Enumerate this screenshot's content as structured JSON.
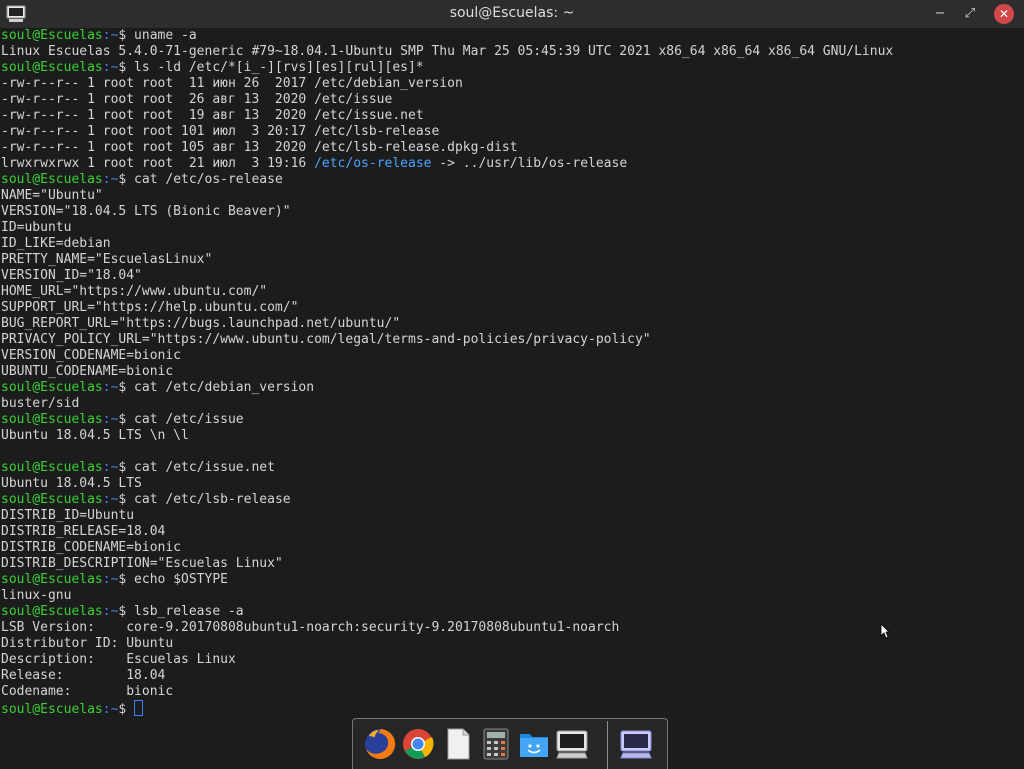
{
  "window": {
    "title": "soul@Escuelas: ~",
    "minimize_glyph": "−",
    "maximize_glyph": "⤢",
    "close_glyph": "✕"
  },
  "prompt": {
    "user": "soul@Escuelas",
    "path": ":~",
    "symbol": "$"
  },
  "terminal": {
    "lines": [
      {
        "p": true,
        "t": " uname -a"
      },
      {
        "t": "Linux Escuelas 5.4.0-71-generic #79~18.04.1-Ubuntu SMP Thu Mar 25 05:45:39 UTC 2021 x86_64 x86_64 x86_64 GNU/Linux"
      },
      {
        "p": true,
        "t": " ls -ld /etc/*[i_-][rvs][es][rul][es]*"
      },
      {
        "t": "-rw-r--r-- 1 root root  11 июн 26  2017 /etc/debian_version"
      },
      {
        "t": "-rw-r--r-- 1 root root  26 авг 13  2020 /etc/issue"
      },
      {
        "t": "-rw-r--r-- 1 root root  19 авг 13  2020 /etc/issue.net"
      },
      {
        "t": "-rw-r--r-- 1 root root 101 июл  3 20:17 /etc/lsb-release"
      },
      {
        "t": "-rw-r--r-- 1 root root 105 авг 13  2020 /etc/lsb-release.dpkg-dist"
      },
      {
        "t": "lrwxrwxrwx 1 root root  21 июл  3 19:16 ",
        "hl": "/etc/os-release",
        "t2": " -> ../usr/lib/os-release"
      },
      {
        "p": true,
        "t": " cat /etc/os-release"
      },
      {
        "t": "NAME=\"Ubuntu\""
      },
      {
        "t": "VERSION=\"18.04.5 LTS (Bionic Beaver)\""
      },
      {
        "t": "ID=ubuntu"
      },
      {
        "t": "ID_LIKE=debian"
      },
      {
        "t": "PRETTY_NAME=\"EscuelasLinux\""
      },
      {
        "t": "VERSION_ID=\"18.04\""
      },
      {
        "t": "HOME_URL=\"https://www.ubuntu.com/\""
      },
      {
        "t": "SUPPORT_URL=\"https://help.ubuntu.com/\""
      },
      {
        "t": "BUG_REPORT_URL=\"https://bugs.launchpad.net/ubuntu/\""
      },
      {
        "t": "PRIVACY_POLICY_URL=\"https://www.ubuntu.com/legal/terms-and-policies/privacy-policy\""
      },
      {
        "t": "VERSION_CODENAME=bionic"
      },
      {
        "t": "UBUNTU_CODENAME=bionic"
      },
      {
        "p": true,
        "t": " cat /etc/debian_version"
      },
      {
        "t": "buster/sid"
      },
      {
        "p": true,
        "t": " cat /etc/issue"
      },
      {
        "t": "Ubuntu 18.04.5 LTS \\n \\l"
      },
      {
        "t": ""
      },
      {
        "p": true,
        "t": " cat /etc/issue.net"
      },
      {
        "t": "Ubuntu 18.04.5 LTS"
      },
      {
        "p": true,
        "t": " cat /etc/lsb-release"
      },
      {
        "t": "DISTRIB_ID=Ubuntu"
      },
      {
        "t": "DISTRIB_RELEASE=18.04"
      },
      {
        "t": "DISTRIB_CODENAME=bionic"
      },
      {
        "t": "DISTRIB_DESCRIPTION=\"Escuelas Linux\""
      },
      {
        "p": true,
        "t": " echo $OSTYPE"
      },
      {
        "t": "linux-gnu"
      },
      {
        "p": true,
        "t": " lsb_release -a"
      },
      {
        "t": "LSB Version:    core-9.20170808ubuntu1-noarch:security-9.20170808ubuntu1-noarch"
      },
      {
        "t": "Distributor ID: Ubuntu"
      },
      {
        "t": "Description:    Escuelas Linux"
      },
      {
        "t": "Release:        18.04"
      },
      {
        "t": "Codename:       bionic"
      },
      {
        "p": true,
        "t": " ",
        "cursor": true
      }
    ]
  },
  "dock": {
    "items": [
      {
        "name": "firefox-icon",
        "label": "Firefox"
      },
      {
        "name": "chrome-icon",
        "label": "Chrome"
      },
      {
        "name": "document-icon",
        "label": "Text Editor"
      },
      {
        "name": "calculator-icon",
        "label": "Calculator"
      },
      {
        "name": "file-manager-icon",
        "label": "Files"
      },
      {
        "name": "terminal-icon",
        "label": "Terminal"
      },
      {
        "name": "terminal-icon-active",
        "label": "Terminal (running)"
      }
    ]
  },
  "colors": {
    "prompt_user": "#38d230",
    "prompt_path": "#3b82ff",
    "link": "#4aa3ff",
    "text": "#d4d4d4",
    "background": "#1c1c1c"
  }
}
